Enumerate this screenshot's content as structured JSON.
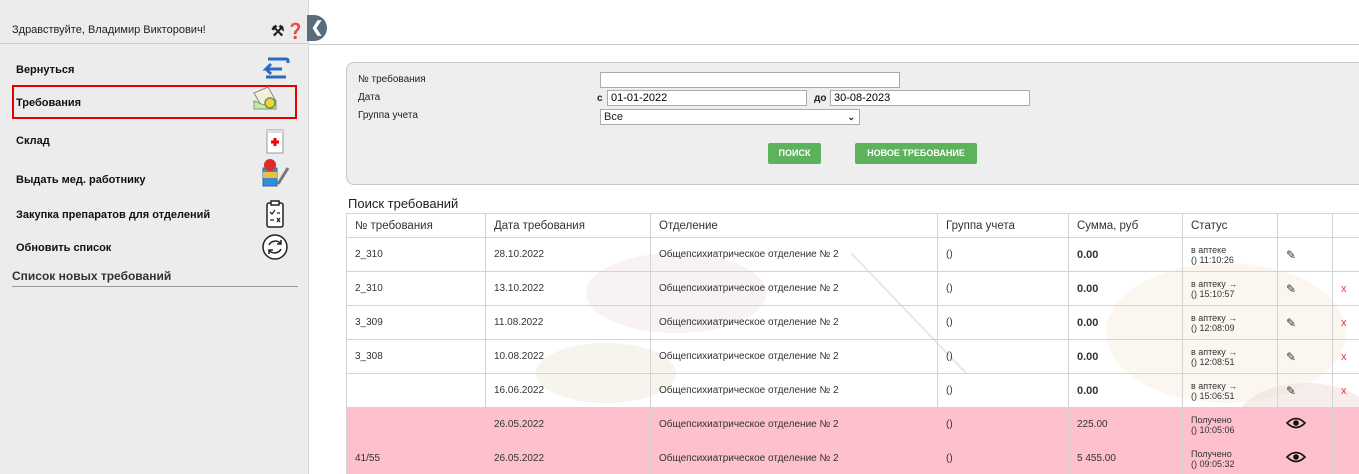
{
  "header": {
    "greeting": "Здравствуйте, Владимир Викторович!"
  },
  "sidebar": {
    "items": [
      {
        "label": "Вернуться",
        "icon": "back-arrow-icon"
      },
      {
        "label": "Требования",
        "icon": "requests-icon",
        "active": true
      },
      {
        "label": "Склад",
        "icon": "warehouse-icon"
      },
      {
        "label": "Выдать мед. работнику",
        "icon": "give-medicine-icon"
      },
      {
        "label": "Закупка препаратов для отделений",
        "icon": "purchase-list-icon"
      },
      {
        "label": "Обновить список",
        "icon": "refresh-icon"
      }
    ],
    "new_list_title": "Список новых требований"
  },
  "filter": {
    "number_label": "№ требования",
    "number_value": "",
    "date_label": "Дата",
    "date_from_prefix": "с",
    "date_from": "01-01-2022",
    "date_to_prefix": "до",
    "date_to": "30-08-2023",
    "group_label": "Группа учета",
    "group_value": "Все",
    "search_btn": "ПОИСК",
    "new_btn": "НОВОЕ ТРЕБОВАНИЕ"
  },
  "results": {
    "title": "Поиск требований",
    "columns": [
      "№ требования",
      "Дата требования",
      "Отделение",
      "Группа учета",
      "Сумма, руб",
      "Статус",
      "",
      ""
    ],
    "rows": [
      {
        "num": "2_310",
        "date": "28.10.2022",
        "dept": "Общепсихиатрическое отделение № 2",
        "group": "()",
        "sum": "0.00",
        "status1": "в аптеке",
        "status2": "() 11:10:26",
        "action": "edit",
        "delete": ""
      },
      {
        "num": "2_310",
        "date": "13.10.2022",
        "dept": "Общепсихиатрическое отделение № 2",
        "group": "()",
        "sum": "0.00",
        "status1": "в аптеку →",
        "status2": "() 15:10:57",
        "action": "edit",
        "delete": "x"
      },
      {
        "num": "3_309",
        "date": "11.08.2022",
        "dept": "Общепсихиатрическое отделение № 2",
        "group": "()",
        "sum": "0.00",
        "status1": "в аптеку →",
        "status2": "() 12:08:09",
        "action": "edit",
        "delete": "x"
      },
      {
        "num": "3_308",
        "date": "10.08.2022",
        "dept": "Общепсихиатрическое отделение № 2",
        "group": "()",
        "sum": "0.00",
        "status1": "в аптеку →",
        "status2": "() 12:08:51",
        "action": "edit",
        "delete": "x"
      },
      {
        "num": "",
        "date": "16.06.2022",
        "dept": "Общепсихиатрическое отделение № 2",
        "group": "()",
        "sum": "0.00",
        "status1": "в аптеку →",
        "status2": "() 15:06:51",
        "action": "edit",
        "delete": "x"
      },
      {
        "num": "",
        "date": "26.05.2022",
        "dept": "Общепсихиатрическое отделение № 2",
        "group": "()",
        "sum": "225.00",
        "status1": "Получено",
        "status2": "() 10:05:06",
        "action": "view",
        "delete": "",
        "highlight": true
      },
      {
        "num": "41/55",
        "date": "26.05.2022",
        "dept": "Общепсихиатрическое отделение № 2",
        "group": "()",
        "sum": "5 455.00",
        "status1": "Получено",
        "status2": "() 09:05:32",
        "action": "view",
        "delete": "",
        "highlight": true
      }
    ]
  },
  "colors": {
    "accent_green": "#5cb35c",
    "highlight_row": "#fec0cc",
    "active_border": "#e30000",
    "delete_x": "#e33333"
  }
}
